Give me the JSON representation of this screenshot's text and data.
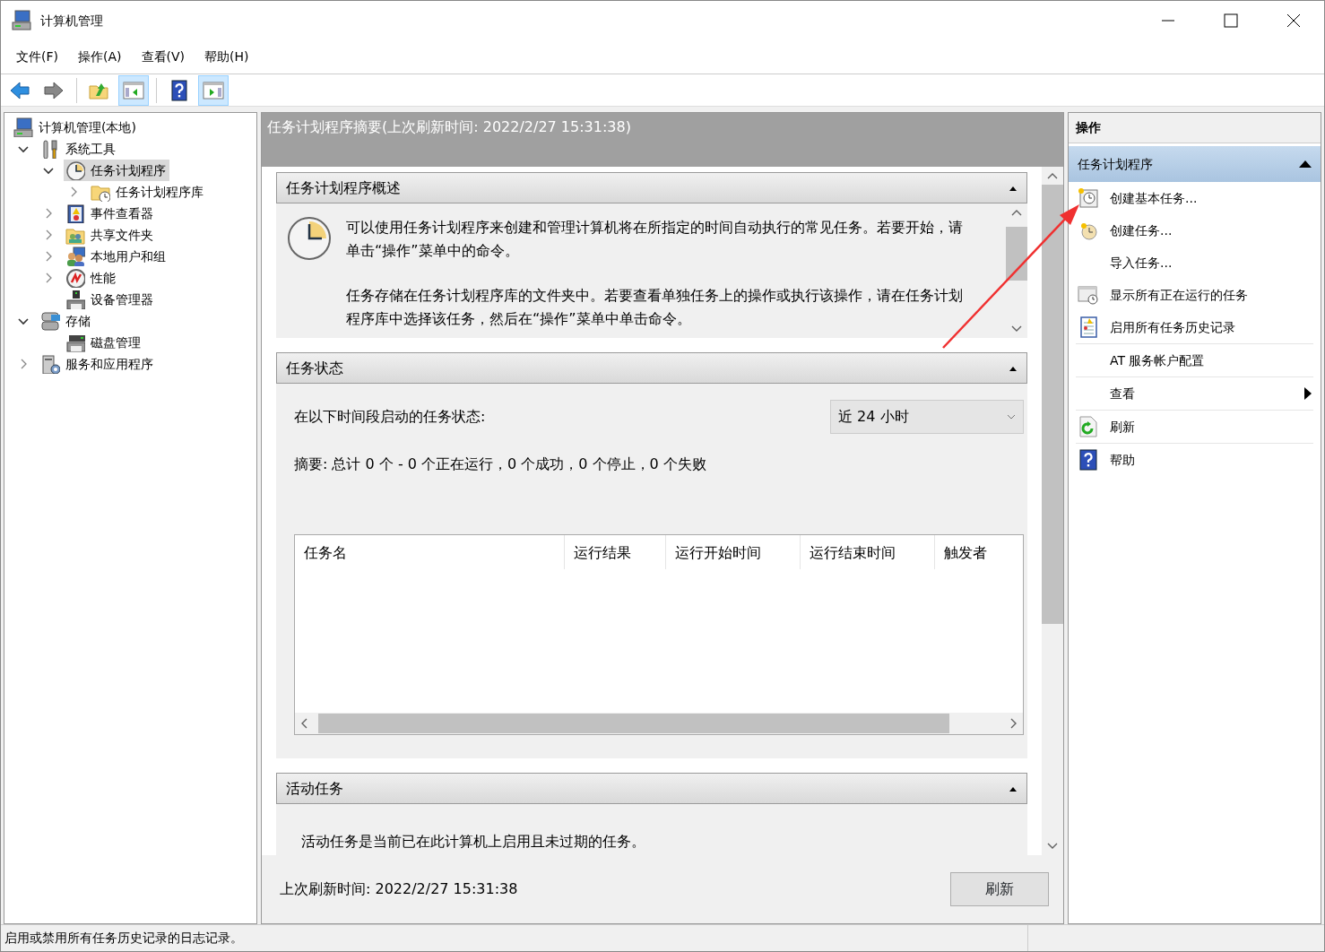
{
  "window": {
    "title": "计算机管理"
  },
  "menu": [
    "文件(F)",
    "操作(A)",
    "查看(V)",
    "帮助(H)"
  ],
  "toolbar": [
    {
      "kind": "back",
      "on": false
    },
    {
      "kind": "forward",
      "on": false
    },
    {
      "kind": "up",
      "on": false
    },
    {
      "kind": "tree",
      "on": true
    },
    {
      "kind": "help",
      "on": false
    },
    {
      "kind": "pane",
      "on": true
    }
  ],
  "tree": [
    {
      "label": "计算机管理(本地)",
      "kind": "computer",
      "selected": false,
      "children": [
        {
          "label": "系统工具",
          "kind": "tools",
          "expanded": true,
          "selected": false,
          "children": [
            {
              "label": "任务计划程序",
              "kind": "clock",
              "expanded": true,
              "selected": true,
              "children": [
                {
                  "label": "任务计划程序库",
                  "kind": "folder-clock",
                  "expanded": false,
                  "selected": false
                }
              ]
            },
            {
              "label": "事件查看器",
              "kind": "log",
              "expanded": false,
              "selected": false
            },
            {
              "label": "共享文件夹",
              "kind": "share",
              "expanded": false,
              "selected": false
            },
            {
              "label": "本地用户和组",
              "kind": "users",
              "expanded": false,
              "selected": false
            },
            {
              "label": "性能",
              "kind": "gauge",
              "expanded": false,
              "selected": false
            },
            {
              "label": "设备管理器",
              "kind": "device",
              "selected": false
            }
          ]
        },
        {
          "label": "存储",
          "kind": "storage",
          "expanded": true,
          "selected": false,
          "children": [
            {
              "label": "磁盘管理",
              "kind": "disk",
              "selected": false
            }
          ]
        },
        {
          "label": "服务和应用程序",
          "kind": "services",
          "expanded": false,
          "selected": false
        }
      ]
    }
  ],
  "summary": {
    "title": "任务计划程序摘要(上次刷新时间: 2022/2/27 15:31:38)",
    "overview": {
      "title": "任务计划程序概述",
      "expanded": true,
      "paragraphs": [
        "可以使用任务计划程序来创建和管理计算机将在所指定的时间自动执行的常见任务。若要开始，请单击“操作”菜单中的命令。",
        "任务存储在任务计划程序库的文件夹中。若要查看单独任务上的操作或执行该操作，请在任务计划程序库中选择该任务，然后在“操作”菜单中单击命令。"
      ]
    },
    "status": {
      "title": "任务状态",
      "expanded": true,
      "label": "在以下时间段启动的任务状态:",
      "dropdown": {
        "value": "近 24 小时"
      },
      "summary": "摘要: 总计 0 个 - 0 个正在运行，0 个成功，0 个停止，0 个失败",
      "table": {
        "columns": [
          "任务名",
          "运行结果",
          "运行开始时间",
          "运行结束时间",
          "触发者"
        ]
      }
    },
    "active": {
      "title": "活动任务",
      "expanded": true,
      "text": "活动任务是当前已在此计算机上启用且未过期的任务。"
    },
    "footer": {
      "refresh_time": "上次刷新时间: 2022/2/27 15:31:38",
      "button": "刷新"
    }
  },
  "actions": {
    "title": "操作",
    "group": {
      "title": "任务计划程序",
      "expanded": true
    },
    "groups": [
      [
        {
          "label": "创建基本任务...",
          "kind": "basic-task",
          "submenu": false
        },
        {
          "label": "创建任务...",
          "kind": "task",
          "submenu": false
        },
        {
          "label": "导入任务...",
          "kind": "plain",
          "submenu": false
        },
        {
          "label": "显示所有正在运行的任务",
          "kind": "running",
          "submenu": false
        },
        {
          "label": "启用所有任务历史记录",
          "kind": "history",
          "submenu": false
        }
      ],
      [
        {
          "label": "AT 服务帐户配置",
          "kind": "plain",
          "submenu": false
        }
      ],
      [
        {
          "label": "查看",
          "kind": "plain",
          "submenu": true
        }
      ],
      [
        {
          "label": "刷新",
          "kind": "refresh",
          "submenu": false
        }
      ],
      [
        {
          "label": "帮助",
          "kind": "help",
          "submenu": false
        }
      ]
    ]
  },
  "status_bar": "启用或禁用所有任务历史记录的日志记录。"
}
